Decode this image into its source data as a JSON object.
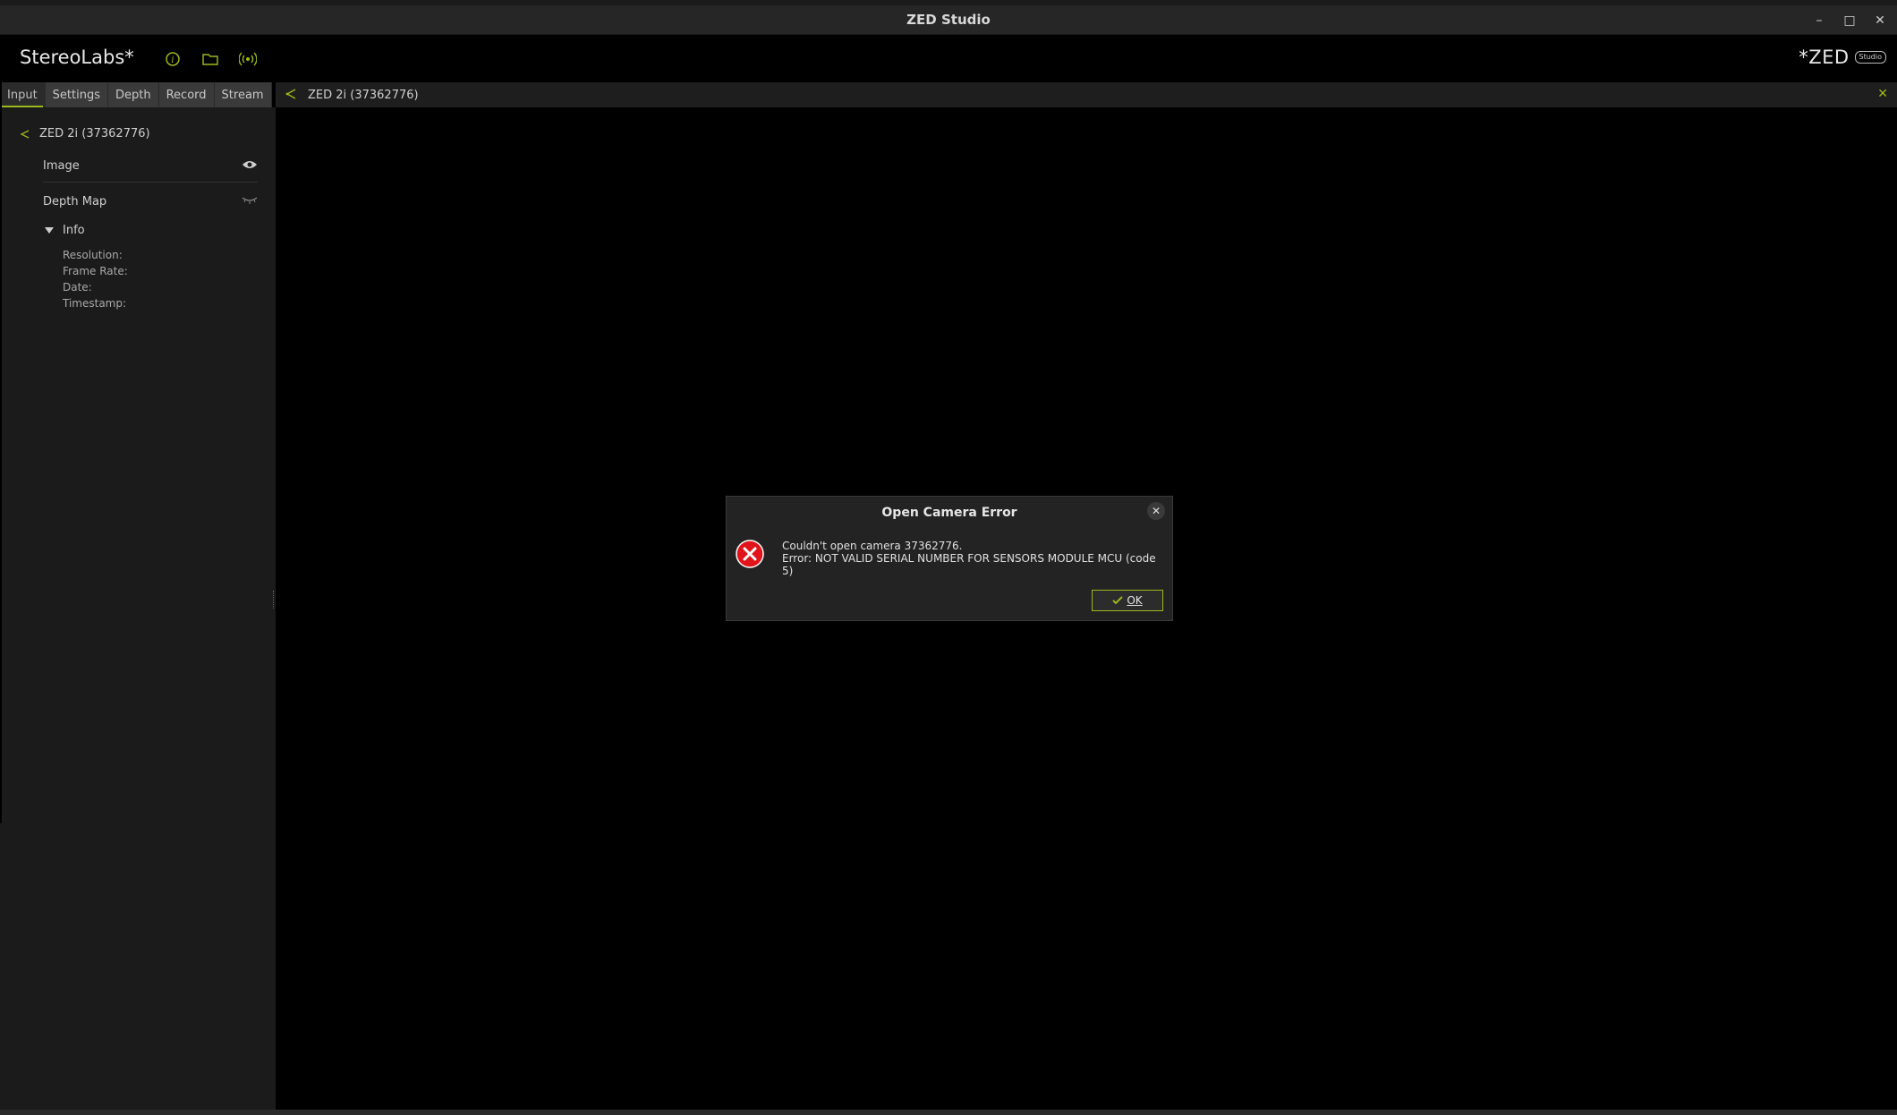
{
  "window": {
    "title": "ZED Studio",
    "minimize": "–",
    "maximize": "□",
    "close": "✕"
  },
  "header": {
    "brand": "StereoLabs*",
    "logo_text": "*ZED",
    "logo_badge": "Studio",
    "icons": [
      "info-icon",
      "folder-icon",
      "stream-icon"
    ]
  },
  "tabs": [
    {
      "label": "Input",
      "active": true
    },
    {
      "label": "Settings",
      "active": false
    },
    {
      "label": "Depth",
      "active": false
    },
    {
      "label": "Record",
      "active": false
    },
    {
      "label": "Stream",
      "active": false
    }
  ],
  "camera_bar": {
    "label": "ZED 2i (37362776)",
    "close": "✕"
  },
  "sidebar": {
    "camera_label": "ZED 2i (37362776)",
    "image_label": "Image",
    "depth_label": "Depth Map",
    "info_label": "Info",
    "info_fields": {
      "resolution": "Resolution:",
      "frame_rate": "Frame Rate:",
      "date": "Date:",
      "timestamp": "Timestamp:"
    }
  },
  "dialog": {
    "title": "Open Camera Error",
    "close": "✕",
    "line1": "Couldn't open camera 37362776.",
    "line2": "Error: NOT VALID SERIAL NUMBER FOR SENSORS MODULE MCU (code 5)",
    "ok_label": "OK"
  },
  "colors": {
    "accent": "#9bb81c",
    "error": "#e0141a",
    "background": "#000000",
    "panel": "#1b1b1b"
  }
}
